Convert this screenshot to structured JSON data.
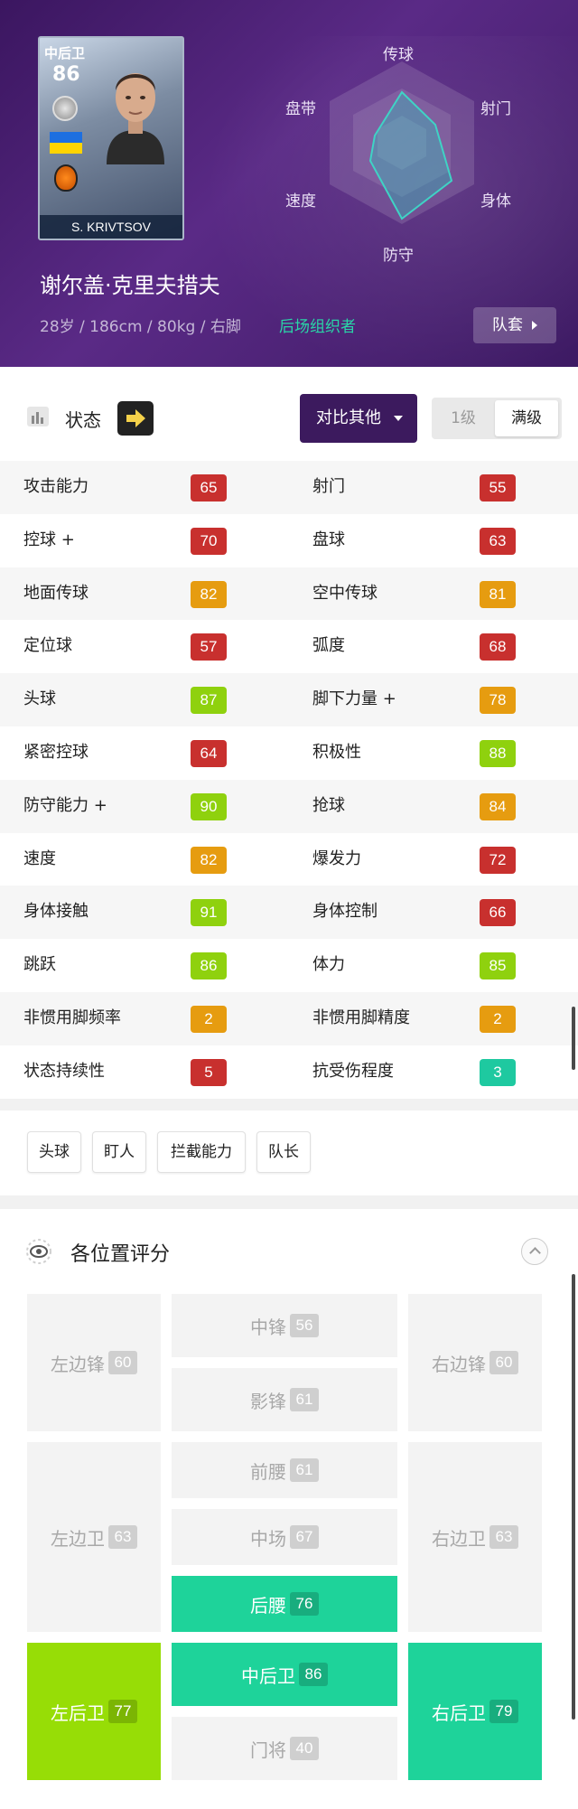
{
  "player": {
    "card_position": "中后卫",
    "card_rating": "86",
    "card_name": "S. KRIVTSOV",
    "name": "谢尔盖·克里夫措夫",
    "meta": "28岁 / 186cm / 80kg / 右脚",
    "role": "后场组织者",
    "kit_button": "队套"
  },
  "radar": {
    "labels": [
      "传球",
      "射门",
      "身体",
      "防守",
      "速度",
      "盘带"
    ]
  },
  "status_bar": {
    "label": "状态",
    "compare_button": "对比其他",
    "level_1": "1级",
    "level_max": "满级"
  },
  "stats": [
    {
      "left_name": "攻击能力",
      "left_value": "65",
      "right_name": "射门",
      "right_value": "55"
    },
    {
      "left_name": "控球 +",
      "left_value": "70",
      "right_name": "盘球",
      "right_value": "63"
    },
    {
      "left_name": "地面传球",
      "left_value": "82",
      "right_name": "空中传球",
      "right_value": "81"
    },
    {
      "left_name": "定位球",
      "left_value": "57",
      "right_name": "弧度",
      "right_value": "68"
    },
    {
      "left_name": "头球",
      "left_value": "87",
      "right_name": "脚下力量 +",
      "right_value": "78"
    },
    {
      "left_name": "紧密控球",
      "left_value": "64",
      "right_name": "积极性",
      "right_value": "88"
    },
    {
      "left_name": "防守能力 +",
      "left_value": "90",
      "right_name": "抢球",
      "right_value": "84"
    },
    {
      "left_name": "速度",
      "left_value": "82",
      "right_name": "爆发力",
      "right_value": "72"
    },
    {
      "left_name": "身体接触",
      "left_value": "91",
      "right_name": "身体控制",
      "right_value": "66"
    },
    {
      "left_name": "跳跃",
      "left_value": "86",
      "right_name": "体力",
      "right_value": "85"
    },
    {
      "left_name": "非惯用脚频率",
      "left_value": "2",
      "right_name": "非惯用脚精度",
      "right_value": "2"
    },
    {
      "left_name": "状态持续性",
      "left_value": "5",
      "right_name": "抗受伤程度",
      "right_value": "3"
    }
  ],
  "stat_colors": {
    "red": "#c8302e",
    "orange": "#e69c10",
    "lime": "#8fd10e",
    "teal": "#1ec9a0"
  },
  "skills": [
    "头球",
    "盯人",
    "拦截能力",
    "队长"
  ],
  "positions_section": {
    "title": "各位置评分",
    "positions": {
      "lwf": {
        "name": "左边锋",
        "value": "60"
      },
      "cf": {
        "name": "中锋",
        "value": "56"
      },
      "rwf": {
        "name": "右边锋",
        "value": "60"
      },
      "ss": {
        "name": "影锋",
        "value": "61"
      },
      "amf": {
        "name": "前腰",
        "value": "61"
      },
      "lmf": {
        "name": "左边卫",
        "value": "63"
      },
      "cmf": {
        "name": "中场",
        "value": "67"
      },
      "rmf": {
        "name": "右边卫",
        "value": "63"
      },
      "dmf": {
        "name": "后腰",
        "value": "76"
      },
      "lb": {
        "name": "左后卫",
        "value": "77"
      },
      "cb": {
        "name": "中后卫",
        "value": "86"
      },
      "rb": {
        "name": "右后卫",
        "value": "79"
      },
      "gk": {
        "name": "门将",
        "value": "40"
      }
    }
  }
}
